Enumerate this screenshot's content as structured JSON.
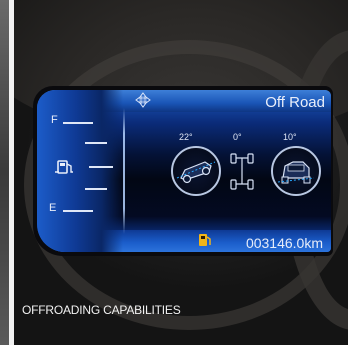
{
  "display": {
    "mode_label": "Off Road",
    "fuel_full_label": "F",
    "fuel_empty_label": "E",
    "pitch_angle": "22°",
    "axle_angle": "0°",
    "roll_angle": "10°",
    "odometer": "003146.0km"
  },
  "caption": "OFFROADING CAPABILITIES",
  "colors": {
    "screen_blue": "#1a56b8",
    "accent_cyan": "#27a8ff",
    "warning_amber": "#f0b419"
  }
}
